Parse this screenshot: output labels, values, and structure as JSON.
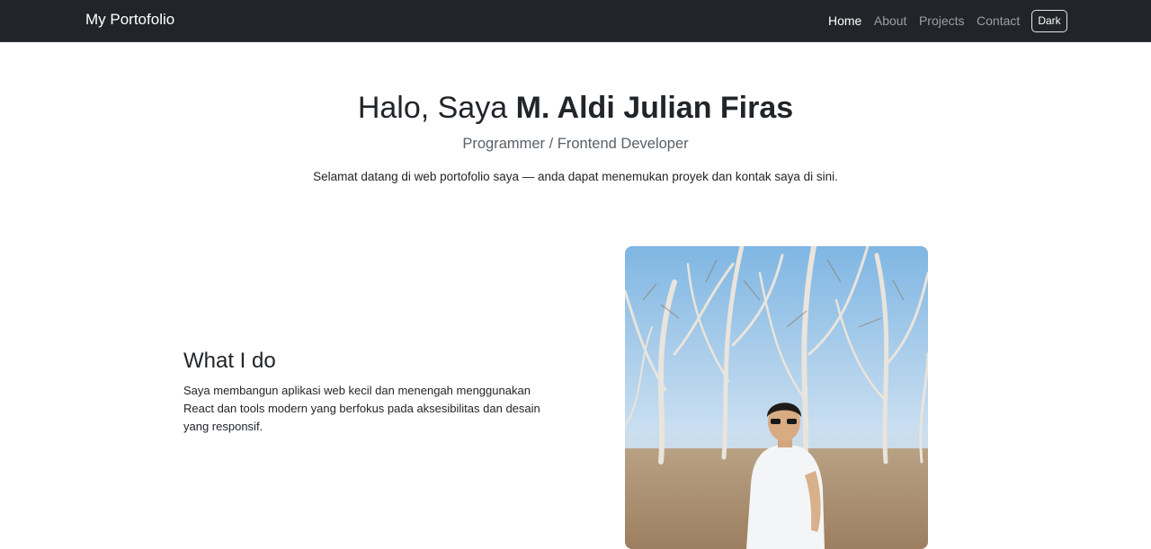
{
  "navbar": {
    "brand": "My Portofolio",
    "links": [
      {
        "label": "Home",
        "active": true
      },
      {
        "label": "About",
        "active": false
      },
      {
        "label": "Projects",
        "active": false
      },
      {
        "label": "Contact",
        "active": false
      }
    ],
    "theme_toggle_label": "Dark"
  },
  "hero": {
    "greeting": "Halo, Saya",
    "name": "M. Aldi Julian Firas",
    "subtitle": "Programmer / Frontend Developer",
    "lead": "Selamat datang di web portofolio saya — anda dapat menemukan proyek dan kontak saya di sini."
  },
  "about": {
    "heading": "What I do",
    "text": "Saya membangun aplikasi web kecil dan menengah menggunakan React dan tools modern yang berfokus pada aksesibilitas dan desain yang responsif."
  },
  "colors": {
    "navbar_bg": "#212529",
    "text_primary": "#212529",
    "text_muted": "#5a6168",
    "nav_link_inactive": "#9ba0a6"
  }
}
